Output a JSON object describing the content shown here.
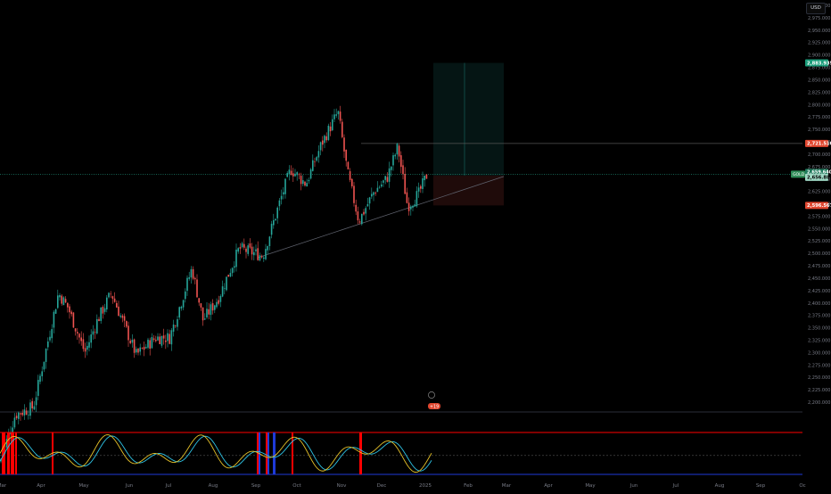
{
  "currency": "USD",
  "symbol_tag": "GOLD",
  "last_price": "2,659.640",
  "countdown": "18:35:20",
  "level_labels": {
    "target": "2,883.935",
    "resistance": "2,721.510",
    "entry": "2,656.881",
    "stop": "2,596.567"
  },
  "event_badge": "+19",
  "price_ticks": [
    "3,000.000",
    "2,975.000",
    "2,950.000",
    "2,925.000",
    "2,900.000",
    "2,875.000",
    "2,850.000",
    "2,825.000",
    "2,800.000",
    "2,775.000",
    "2,750.000",
    "2,725.000",
    "2,700.000",
    "2,675.000",
    "2,650.000",
    "2,625.000",
    "2,600.000",
    "2,575.000",
    "2,550.000",
    "2,525.000",
    "2,500.000",
    "2,475.000",
    "2,450.000",
    "2,425.000",
    "2,400.000",
    "2,375.000",
    "2,350.000",
    "2,325.000",
    "2,300.000",
    "2,275.000",
    "2,250.000",
    "2,225.000",
    "2,200.000"
  ],
  "month_labels": [
    "Mar",
    "Apr",
    "May",
    "Jun",
    "Jul",
    "Aug",
    "Sep",
    "Oct",
    "Nov",
    "Dec",
    "2025",
    "Feb",
    "Mar",
    "Apr",
    "May",
    "Jun",
    "Jul",
    "Aug",
    "Sep",
    "Oc"
  ],
  "osc_ticks": [
    "80.00%",
    "40.00%",
    "0.00%"
  ],
  "colors": {
    "up": "#26a69a",
    "down": "#ef5350",
    "background": "#000000",
    "axis_text": "#787b86",
    "target_zone": "#26a69a",
    "stop_zone": "#ef5350",
    "osc_fast": "#e6c229",
    "osc_slow": "#2ec4e6",
    "osc_top": "#ff0000",
    "osc_bottom": "#1e3ad8"
  },
  "chart_data": {
    "type": "candlestick",
    "x": [
      "2024-03-01",
      "2024-12-31"
    ],
    "ylim": [
      2180,
      3010
    ],
    "candle_anchors": [
      {
        "date": "2024-03-01",
        "close": 2080
      },
      {
        "date": "2024-03-12",
        "close": 2175
      },
      {
        "date": "2024-03-25",
        "close": 2190
      },
      {
        "date": "2024-04-05",
        "close": 2330
      },
      {
        "date": "2024-04-12",
        "close": 2420
      },
      {
        "date": "2024-04-19",
        "close": 2390
      },
      {
        "date": "2024-05-01",
        "close": 2300
      },
      {
        "date": "2024-05-10",
        "close": 2365
      },
      {
        "date": "2024-05-20",
        "close": 2420
      },
      {
        "date": "2024-06-07",
        "close": 2295
      },
      {
        "date": "2024-06-21",
        "close": 2330
      },
      {
        "date": "2024-07-01",
        "close": 2330
      },
      {
        "date": "2024-07-17",
        "close": 2470
      },
      {
        "date": "2024-07-25",
        "close": 2365
      },
      {
        "date": "2024-08-05",
        "close": 2410
      },
      {
        "date": "2024-08-20",
        "close": 2510
      },
      {
        "date": "2024-09-06",
        "close": 2495
      },
      {
        "date": "2024-09-20",
        "close": 2620
      },
      {
        "date": "2024-09-26",
        "close": 2670
      },
      {
        "date": "2024-10-07",
        "close": 2640
      },
      {
        "date": "2024-10-18",
        "close": 2720
      },
      {
        "date": "2024-10-30",
        "close": 2785
      },
      {
        "date": "2024-11-06",
        "close": 2660
      },
      {
        "date": "2024-11-14",
        "close": 2565
      },
      {
        "date": "2024-11-25",
        "close": 2625
      },
      {
        "date": "2024-12-04",
        "close": 2650
      },
      {
        "date": "2024-12-12",
        "close": 2715
      },
      {
        "date": "2024-12-19",
        "close": 2595
      },
      {
        "date": "2024-12-27",
        "close": 2620
      },
      {
        "date": "2025-01-02",
        "close": 2659
      }
    ],
    "levels": {
      "target": 2883.935,
      "resistance": 2721.51,
      "last": 2659.64,
      "entry": 2656.881,
      "stop": 2596.567
    },
    "oscillator": {
      "levels_pct": [
        80,
        40,
        0
      ]
    }
  }
}
